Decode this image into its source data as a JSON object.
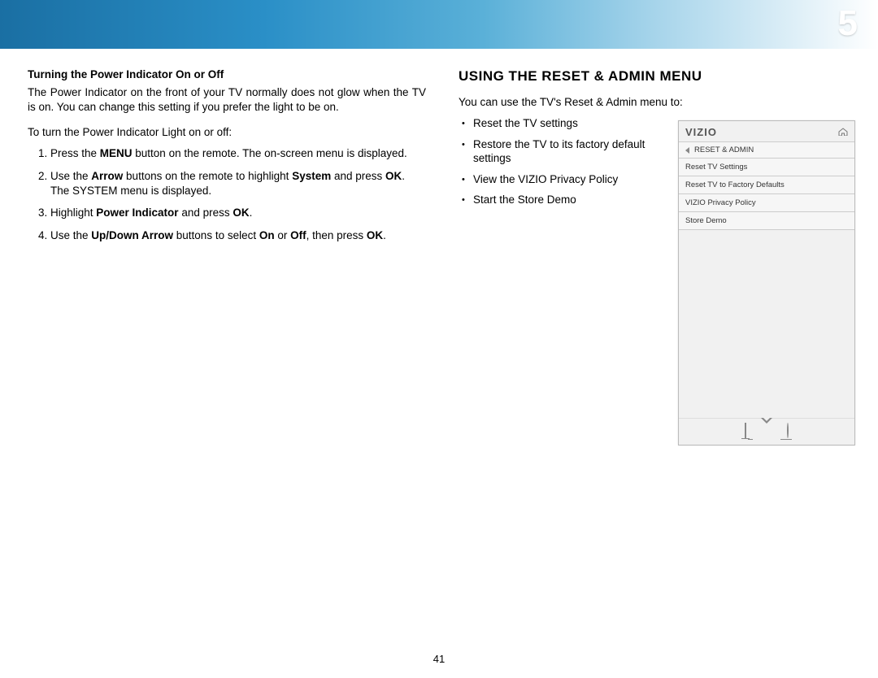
{
  "chapter_number": "5",
  "page_number": "41",
  "left": {
    "subhead": "Turning the Power Indicator On or Off",
    "para": "The Power Indicator on the front of your TV normally does not glow when the TV is on. You can change this setting if you prefer the light to be on.",
    "instruction": "To turn the Power Indicator Light on or off:",
    "steps": {
      "s1a": "Press the ",
      "s1b": "MENU",
      "s1c": " button on the remote. The on-screen menu is displayed.",
      "s2a": "Use the ",
      "s2b": "Arrow",
      "s2c": " buttons on the remote to highlight ",
      "s2d": "System",
      "s2e": " and press ",
      "s2f": "OK",
      "s2g": ". The SYSTEM menu is displayed.",
      "s3a": "Highlight ",
      "s3b": "Power Indicator",
      "s3c": " and press ",
      "s3d": "OK",
      "s3e": ".",
      "s4a": "Use the ",
      "s4b": "Up/Down Arrow",
      "s4c": " buttons to select ",
      "s4d": "On",
      "s4e": " or ",
      "s4f": "Off",
      "s4g": ", then press ",
      "s4h": "OK",
      "s4i": "."
    }
  },
  "right": {
    "title": "USING THE RESET & ADMIN MENU",
    "intro": "You can use the TV's Reset & Admin menu to:",
    "bullets": [
      "Reset the TV settings",
      "Restore the TV to its factory default settings",
      "View the VIZIO Privacy Policy",
      "Start the Store Demo"
    ]
  },
  "menu": {
    "brand": "VIZIO",
    "breadcrumb": "RESET & ADMIN",
    "items": [
      "Reset TV Settings",
      "Reset TV to Factory Defaults",
      "VIZIO Privacy Policy",
      "Store Demo"
    ]
  }
}
